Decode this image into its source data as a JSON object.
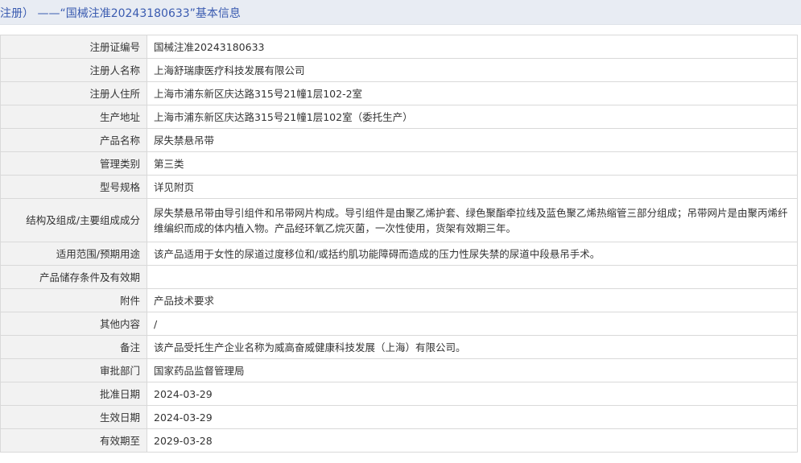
{
  "header": {
    "title": "注册）  ——“国械注准20243180633”基本信息"
  },
  "rows": [
    {
      "label": "注册证编号",
      "value": "国械注准20243180633"
    },
    {
      "label": "注册人名称",
      "value": "上海舒瑞康医疗科技发展有限公司"
    },
    {
      "label": "注册人住所",
      "value": "上海市浦东新区庆达路315号21幢1层102-2室"
    },
    {
      "label": "生产地址",
      "value": "上海市浦东新区庆达路315号21幢1层102室（委托生产）"
    },
    {
      "label": "产品名称",
      "value": "尿失禁悬吊带"
    },
    {
      "label": "管理类别",
      "value": "第三类"
    },
    {
      "label": "型号规格",
      "value": "详见附页"
    },
    {
      "label": "结构及组成/主要组成成分",
      "value": "尿失禁悬吊带由导引组件和吊带网片构成。导引组件是由聚乙烯护套、绿色聚酯牵拉线及蓝色聚乙烯热缩管三部分组成；吊带网片是由聚丙烯纤维编织而成的体内植入物。产品经环氧乙烷灭菌，一次性使用，货架有效期三年。"
    },
    {
      "label": "适用范围/预期用途",
      "value": "该产品适用于女性的尿道过度移位和/或括约肌功能障碍而造成的压力性尿失禁的尿道中段悬吊手术。"
    },
    {
      "label": "产品储存条件及有效期",
      "value": ""
    },
    {
      "label": "附件",
      "value": "产品技术要求"
    },
    {
      "label": "其他内容",
      "value": "/"
    },
    {
      "label": "备注",
      "value": "该产品受托生产企业名称为威高奋威健康科技发展（上海）有限公司。"
    },
    {
      "label": "审批部门",
      "value": "国家药品监督管理局"
    },
    {
      "label": "批准日期",
      "value": "2024-03-29"
    },
    {
      "label": "生效日期",
      "value": "2024-03-29"
    },
    {
      "label": "有效期至",
      "value": "2029-03-28"
    }
  ]
}
